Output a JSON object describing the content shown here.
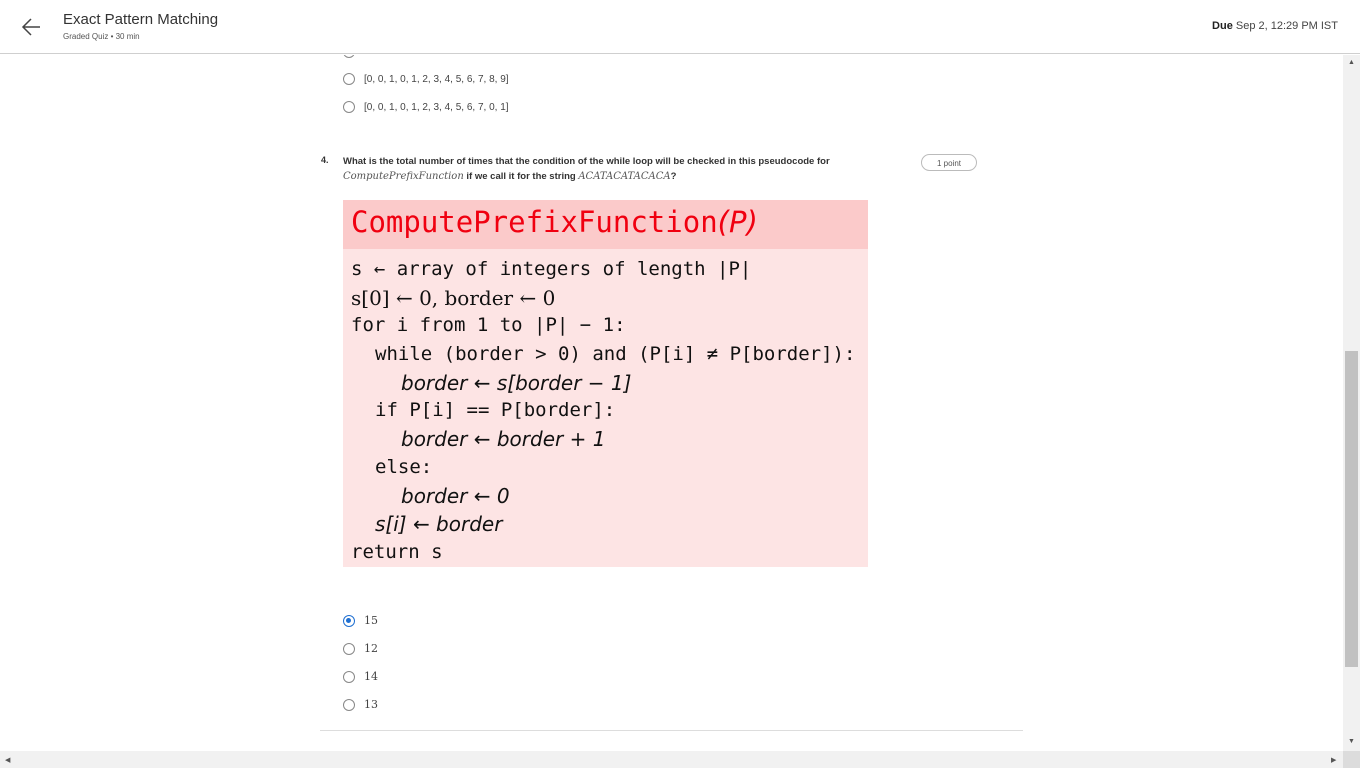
{
  "header": {
    "title": "Exact Pattern Matching",
    "subtitle": "Graded Quiz • 30 min",
    "due_label": "Due",
    "due_value": "Sep 2, 12:29 PM IST"
  },
  "prev_question": {
    "options": [
      "[0, 0, 1, 0, 1, 2, 3, 4, 5, 6, 7, 8, 9]",
      "[0, 0, 1, 0, 1, 2, 3, 4, 5, 6, 7, 0, 1]"
    ]
  },
  "question": {
    "number": "4.",
    "text_before": "What is the total number of times that the condition of the while loop will be checked in this pseudocode for",
    "function_name": "ComputePrefixFunction",
    "text_middle": "if we call it for the string",
    "string_value": "ACATACATACACA",
    "text_after": "?",
    "points": "1 point",
    "algorithm": {
      "title": "ComputePrefixFunction",
      "title_param": "(P)",
      "lines": [
        "s ← array of integers of length |P|",
        "s[0] ← 0, border ← 0",
        "for i from 1 to |P| − 1:",
        "while (border > 0) and (P[i] ≠ P[border]):",
        "border ← s[border − 1]",
        "if P[i] == P[border]:",
        "border ← border + 1",
        "else:",
        "border ← 0",
        "s[i] ← border",
        "return s"
      ]
    },
    "options": [
      {
        "label": "15",
        "selected": true
      },
      {
        "label": "12",
        "selected": false
      },
      {
        "label": "14",
        "selected": false
      },
      {
        "label": "13",
        "selected": false
      }
    ]
  },
  "colors": {
    "accent": "#1f6fd1",
    "algo_title": "#f00010",
    "algo_head_bg": "#fbcaca",
    "algo_body_bg": "#fde4e4"
  }
}
